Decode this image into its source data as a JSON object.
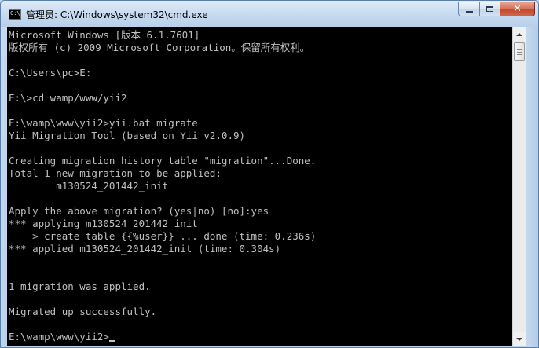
{
  "window": {
    "title": "管理员: C:\\Windows\\system32\\cmd.exe",
    "icon": "cmd-app-icon",
    "icon_text": "C:\\",
    "close_glyph": "✕"
  },
  "console": {
    "text_color": "#c0c0c0",
    "background": "#000000",
    "lines": [
      "Microsoft Windows [版本 6.1.7601]",
      "版权所有 (c) 2009 Microsoft Corporation。保留所有权利。",
      "",
      "C:\\Users\\pc>E:",
      "",
      "E:\\>cd wamp/www/yii2",
      "",
      "E:\\wamp\\www\\yii2>yii.bat migrate",
      "Yii Migration Tool (based on Yii v2.0.9)",
      "",
      "Creating migration history table \"migration\"...Done.",
      "Total 1 new migration to be applied:",
      "        m130524_201442_init",
      "",
      "Apply the above migration? (yes|no) [no]:yes",
      "*** applying m130524_201442_init",
      "    > create table {{%user}} ... done (time: 0.236s)",
      "*** applied m130524_201442_init (time: 0.304s)",
      "",
      "",
      "1 migration was applied.",
      "",
      "Migrated up successfully.",
      "",
      "E:\\wamp\\www\\yii2>"
    ]
  }
}
